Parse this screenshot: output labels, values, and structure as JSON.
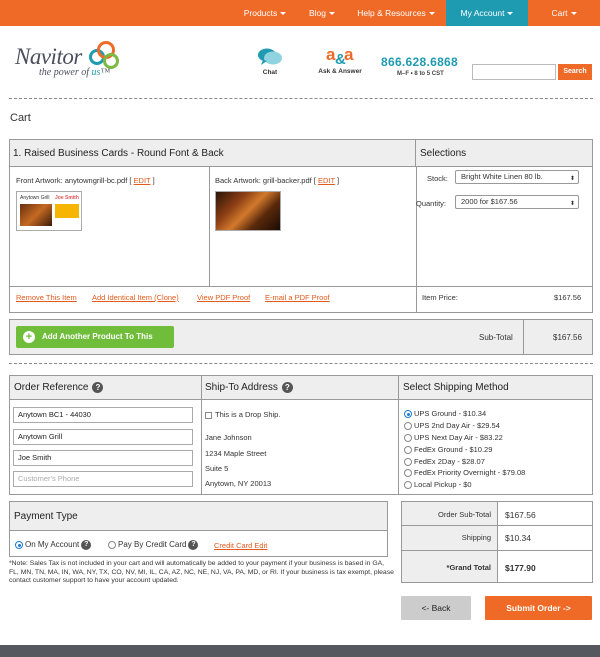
{
  "nav": {
    "items": [
      {
        "label": "Products"
      },
      {
        "label": "Blog"
      },
      {
        "label": "Help & Resources"
      },
      {
        "label": "My Account"
      },
      {
        "label": "Cart"
      }
    ]
  },
  "header": {
    "brand": "Navitor",
    "tagline_pre": "the power of ",
    "tagline_us": "us",
    "tagline_tm": "™",
    "chat_label": "Chat",
    "ask_label": "Ask & Answer",
    "phone": "866.628.6868",
    "hours": "M–F • 8 to 5 CST",
    "search_button": "Search",
    "search_value": ""
  },
  "page_title": "Cart",
  "item": {
    "title": "1. Raised Business Cards - Round Font & Back",
    "front_label": "Front Artwork: anytowngrill-bc.pdf [ ",
    "back_label": "Back Artwork: grill-backer.pdf [ ",
    "edit": "EDIT",
    "close_bracket": " ]",
    "actions": [
      "Remove This Item",
      "Add Identical Item (Clone)",
      "View PDF Proof",
      "E-mail a PDF Proof"
    ],
    "selections_title": "Selections",
    "stock_label": "Stock:",
    "stock_value": "Bright White Linen 80 lb.",
    "quantity_label": "Quantity:",
    "quantity_value": "2000 for $167.56",
    "price_label": "Item Price:",
    "price_value": "$167.56",
    "thumb_front_name": "Anytown Grill",
    "thumb_front_title": "Joe Smith"
  },
  "add_product": {
    "label": "Add Another Product To This Order",
    "subtotal_label": "Sub-Total",
    "subtotal_value": "$167.56"
  },
  "order_ref": {
    "title": "Order Reference",
    "fields": [
      "Anytown BC1 - 44030",
      "Anytown Grill",
      "Joe Smith"
    ],
    "phone_placeholder": "Customer's Phone"
  },
  "ship_to": {
    "title": "Ship-To Address",
    "drop_ship": "This is a Drop Ship.",
    "lines": [
      "Jane Johnson",
      "1234 Maple Street",
      "Suite 5",
      "Anytown, NY 20013"
    ]
  },
  "shipping": {
    "title": "Select Shipping Method",
    "options": [
      "UPS Ground - $10.34",
      "UPS 2nd Day Air - $29.54",
      "UPS Next Day Air - $83.22",
      "FedEx Ground - $10.29",
      "FedEx 2Day - $28.07",
      "FedEx Priority Overnight - $79.08",
      "Local Pickup - $0"
    ]
  },
  "payment": {
    "title": "Payment Type",
    "on_account": "On My Account",
    "credit_card": "Pay By Credit Card",
    "cc_edit": "Credit Card Edit"
  },
  "totals": {
    "subtotal_label": "Order Sub-Total",
    "subtotal_value": "$167.56",
    "shipping_label": "Shipping",
    "shipping_value": "$10.34",
    "grand_label": "*Grand Total",
    "grand_value": "$177.90"
  },
  "note": "*Note: Sales Tax is not included in your cart and will automatically be added to your payment if your business is based in GA, FL, MN, TN, MA, IN, WA, NY, TX, CO, NV, MI, IL, CA, AZ, NC, NE, NJ, VA, PA, MD, or RI. If your business is tax exempt, please contact customer support to have your account updated.",
  "buttons": {
    "back": "<- Back",
    "submit": "Submit Order ->"
  },
  "colors": {
    "accent": "#ee6a26",
    "teal": "#1e9bb1",
    "green": "#6fbd3a"
  }
}
